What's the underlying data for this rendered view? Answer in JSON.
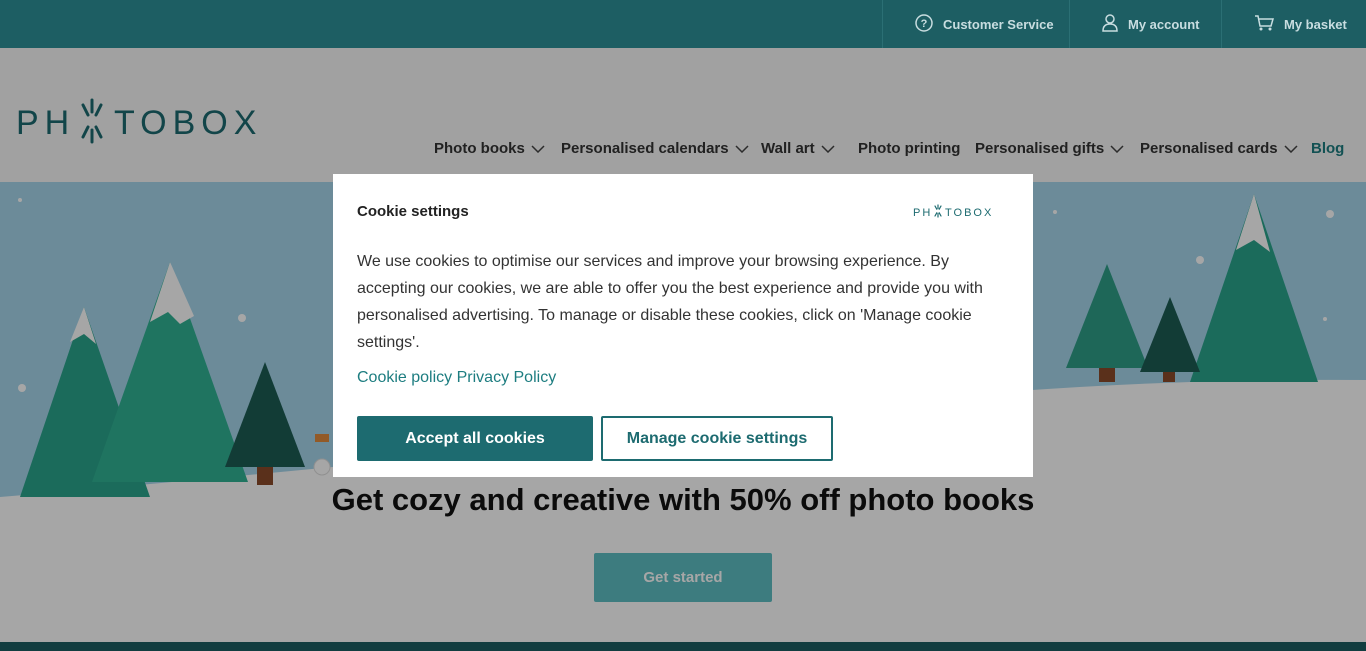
{
  "topbar": {
    "customer_service": "Customer Service",
    "my_account": "My account",
    "my_basket": "My basket"
  },
  "brand": {
    "logo_text": "PHOTOBOX"
  },
  "nav": {
    "items": [
      {
        "label": "Photo books",
        "has_dropdown": true
      },
      {
        "label": "Personalised calendars",
        "has_dropdown": true
      },
      {
        "label": "Wall art",
        "has_dropdown": true
      },
      {
        "label": "Photo printing",
        "has_dropdown": false
      },
      {
        "label": "Personalised gifts",
        "has_dropdown": true
      },
      {
        "label": "Personalised cards",
        "has_dropdown": true
      },
      {
        "label": "Blog",
        "has_dropdown": false
      }
    ]
  },
  "hero": {
    "title": "Get cozy and creative with 50% off photo books",
    "cta_label": "Get started"
  },
  "cookie_modal": {
    "title": "Cookie settings",
    "body": "We use cookies to optimise our services and improve your browsing experience. By accepting our cookies, we are able to offer you the best experience and provide you with personalised advertising. To manage or disable these cookies, click on 'Manage cookie settings'.",
    "link_cookie_policy": "Cookie policy",
    "link_privacy_policy": "Privacy Policy",
    "accept_label": "Accept all cookies",
    "manage_label": "Manage cookie settings"
  },
  "colors": {
    "brand_teal": "#1d5e63",
    "accent_teal": "#1d7d80",
    "cta_light": "#5fbfc4"
  },
  "icons": [
    "help-circle-icon",
    "user-icon",
    "basket-icon",
    "chevron-down-icon"
  ]
}
